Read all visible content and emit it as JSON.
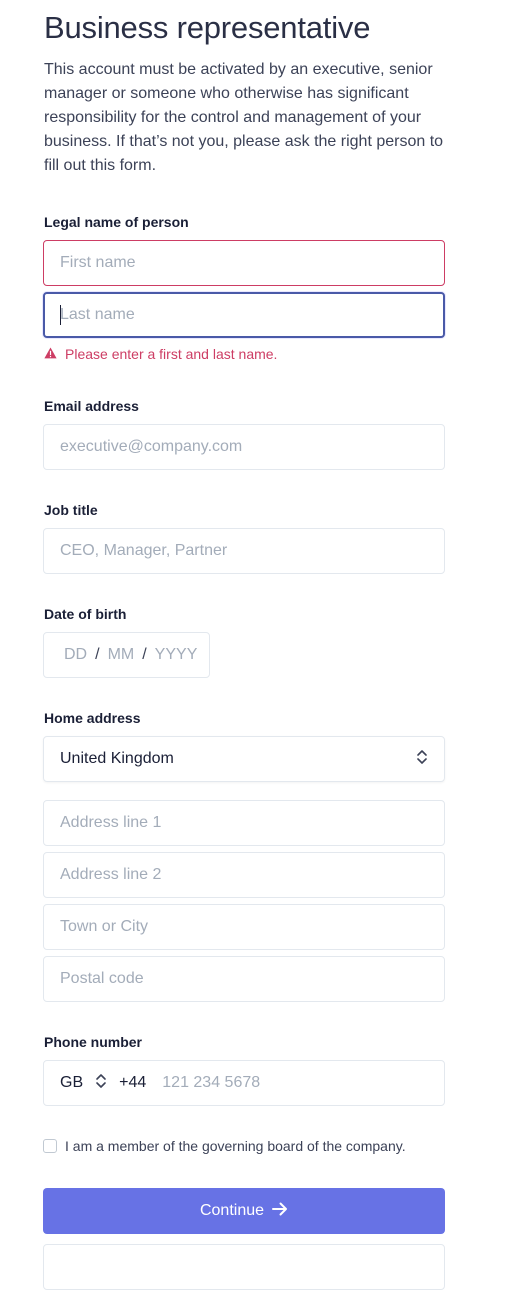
{
  "header": {
    "title": "Business representative",
    "intro": "This account must be activated by an executive, senior manager or someone who otherwise has significant responsibility for the control and management of your business. If that’s not you, please ask the right person to fill out this form."
  },
  "legal_name": {
    "label": "Legal name of person",
    "first_placeholder": "First name",
    "last_placeholder": "Last name",
    "error": "Please enter a first and last name."
  },
  "email": {
    "label": "Email address",
    "placeholder": "executive@company.com"
  },
  "job": {
    "label": "Job title",
    "placeholder": "CEO, Manager, Partner"
  },
  "dob": {
    "label": "Date of birth",
    "dd": "DD",
    "mm": "MM",
    "yyyy": "YYYY",
    "sep": "/"
  },
  "address": {
    "label": "Home address",
    "country": "United Kingdom",
    "line1_placeholder": "Address line 1",
    "line2_placeholder": "Address line 2",
    "city_placeholder": "Town or City",
    "postal_placeholder": "Postal code"
  },
  "phone": {
    "label": "Phone number",
    "country_code": "GB",
    "dial_code": "+44",
    "placeholder": "121 234 5678"
  },
  "board": {
    "label": "I am a member of the governing board of the company."
  },
  "actions": {
    "continue_label": "Continue"
  },
  "colors": {
    "accent": "#6772e5",
    "error": "#cd3d64"
  }
}
